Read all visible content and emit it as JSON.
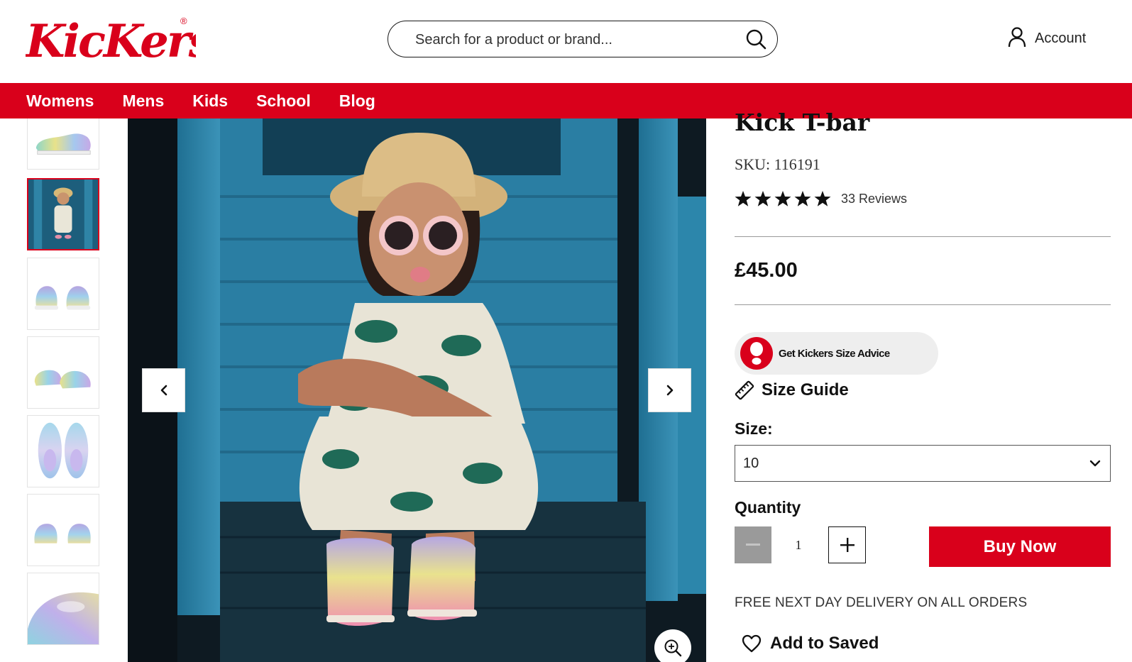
{
  "brand": {
    "logo_text": "KicKers",
    "trademark": "®",
    "color": "#d9001b"
  },
  "search": {
    "placeholder": "Search for a product or brand..."
  },
  "account": {
    "label": "Account"
  },
  "nav": {
    "items": [
      "Womens",
      "Mens",
      "Kids",
      "School",
      "Blog"
    ]
  },
  "gallery": {
    "thumbnails": [
      {
        "icon": "shoe-side-view",
        "active": false
      },
      {
        "icon": "child-lifestyle-photo",
        "active": true
      },
      {
        "icon": "shoe-pair-front-view",
        "active": false
      },
      {
        "icon": "shoe-pair-angle-view",
        "active": false
      },
      {
        "icon": "shoe-pair-top-view",
        "active": false
      },
      {
        "icon": "shoe-pair-back-view",
        "active": false
      },
      {
        "icon": "shoe-closeup-view",
        "active": false
      }
    ],
    "main_image": "child-lifestyle-photo"
  },
  "product": {
    "title": "Kick T-bar",
    "sku": "SKU: 116191",
    "rating": 5,
    "reviews": "33 Reviews",
    "price": "£45.00",
    "size_advice": "Get Kickers Size Advice",
    "size_guide": "Size Guide",
    "size_label": "Size:",
    "size_value": "10",
    "quantity_label": "Quantity",
    "quantity_value": "1",
    "buy_now": "Buy Now",
    "delivery": "FREE NEXT DAY DELIVERY ON ALL ORDERS",
    "add_to_saved": "Add to Saved"
  },
  "colors": {
    "accent": "#d9001b",
    "disabled": "#9a9a9a"
  }
}
